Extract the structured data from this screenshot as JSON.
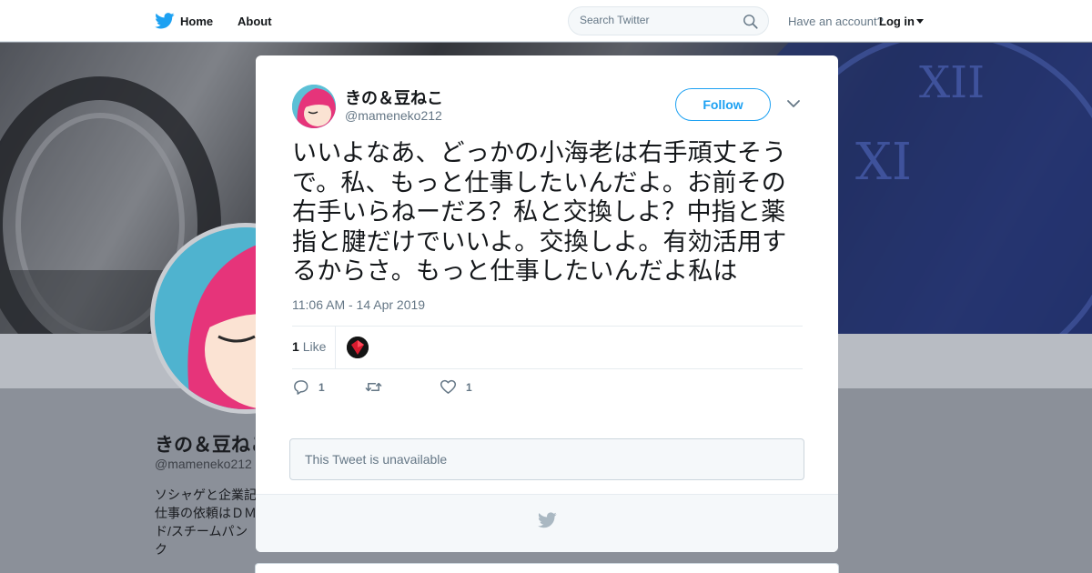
{
  "nav": {
    "home_label": "Home",
    "about_label": "About",
    "search_placeholder": "Search Twitter",
    "have_account": "Have an account?",
    "login_label": "Log in"
  },
  "profile": {
    "name": "きの＆豆ねこ",
    "handle": "@mameneko212",
    "bio": "ソシャゲと企業記\n仕事の依頼はＤＭ\nド/スチームパンク\nご自由に/"
  },
  "tweet": {
    "author_name": "きの＆豆ねこ",
    "author_handle": "@mameneko212",
    "follow_label": "Follow",
    "text": "いいよなあ、どっかの小海老は右手頑丈そうで。私、もっと仕事したいんだよ。お前その右手いらねーだろ？私と交換しよ？中指と薬指と腱だけでいいよ。交換しよ。有効活用するからさ。もっと仕事したいんだよ私は",
    "timestamp": "11:06 AM - 14 Apr 2019",
    "likes_count": "1",
    "likes_label": "Like",
    "reply_count": "1",
    "like_action_count": "1",
    "quoted_unavailable": "This Tweet is unavailable"
  },
  "colors": {
    "brand_blue": "#1da1f2",
    "muted_text": "#657786",
    "border": "#e6ecf0"
  },
  "icons": [
    "twitter-bird-icon",
    "search-icon",
    "close-icon",
    "chevron-down-icon",
    "reply-icon",
    "retweet-icon",
    "heart-icon"
  ]
}
